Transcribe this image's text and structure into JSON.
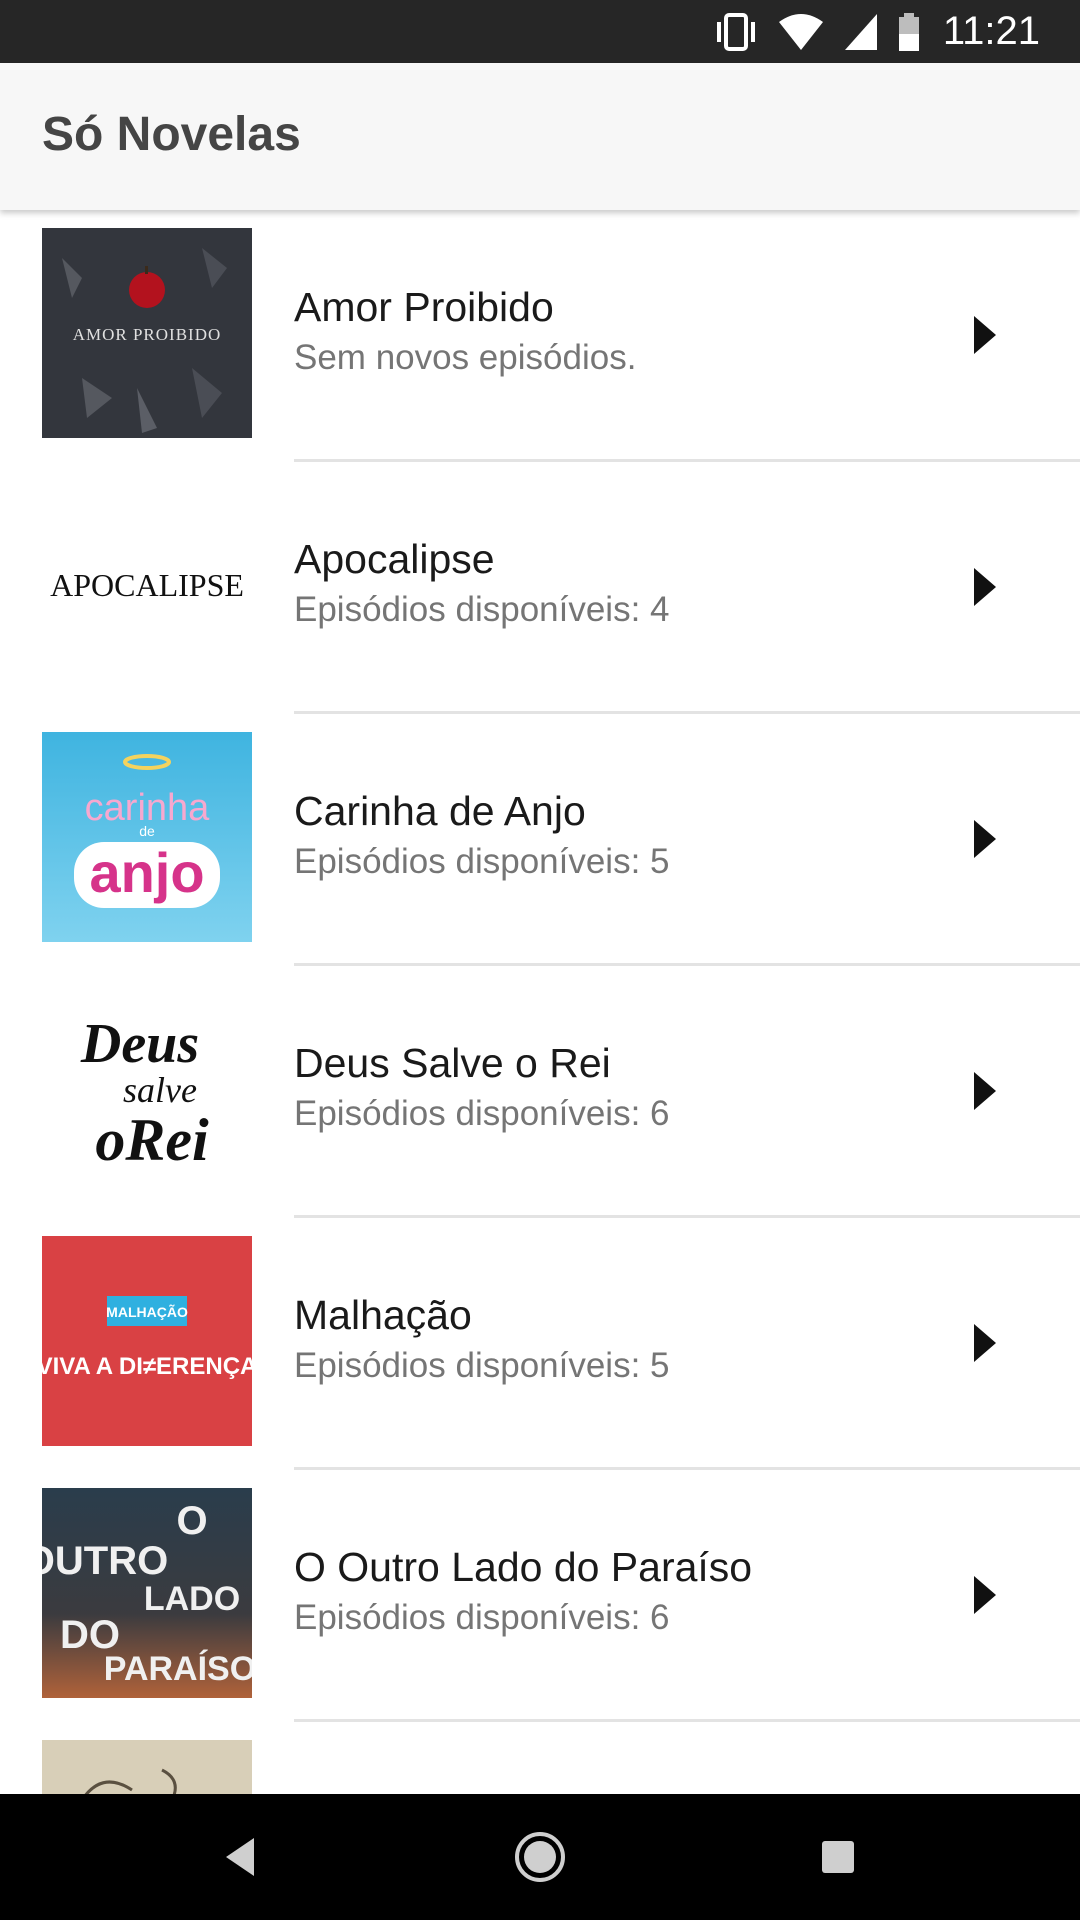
{
  "status_bar": {
    "time": "11:21",
    "icons": [
      "vibrate-icon",
      "wifi-icon",
      "signal-icon",
      "battery-icon"
    ]
  },
  "app_bar": {
    "title": "Só Novelas"
  },
  "novelas": [
    {
      "title": "Amor Proibido",
      "subtitle": "Sem novos episódios.",
      "logo_text": "AMOR PROIBIDO"
    },
    {
      "title": "Apocalipse",
      "subtitle": "Episódios disponíveis: 4",
      "logo_text": "APOCALIPSE"
    },
    {
      "title": "Carinha de Anjo",
      "subtitle": "Episódios disponíveis: 5",
      "logo_text": "carinha de anjo"
    },
    {
      "title": "Deus Salve o Rei",
      "subtitle": "Episódios disponíveis: 6",
      "logo_text": "Deus salve o Rei"
    },
    {
      "title": "Malhação",
      "subtitle": "Episódios disponíveis: 5",
      "logo_text": "MALHAÇÃO VIVA A DI≠ERENÇA"
    },
    {
      "title": "O Outro Lado do Paraíso",
      "subtitle": "Episódios disponíveis: 6",
      "logo_text": "O OUTRO LADO DO PARAÍSO"
    }
  ],
  "nav_bar": {
    "icons": [
      "back-icon",
      "home-icon",
      "recents-icon"
    ]
  }
}
